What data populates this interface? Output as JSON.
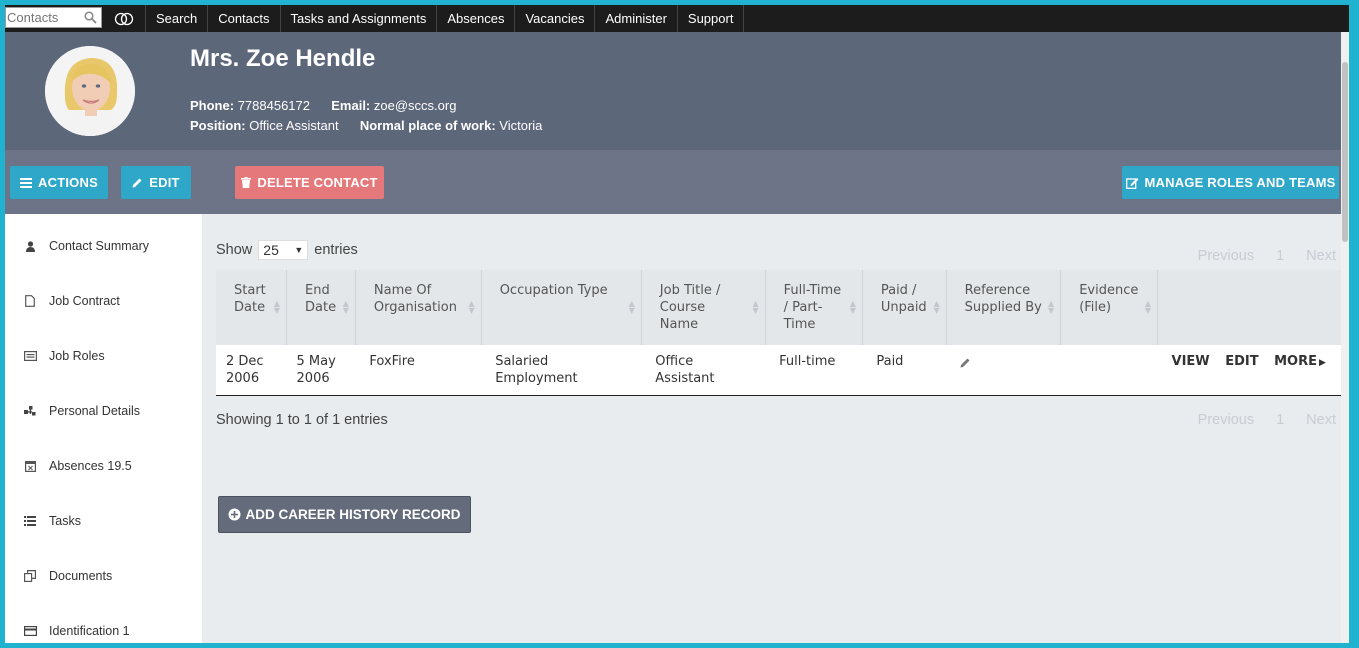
{
  "topnav": {
    "search_placeholder": "Contacts",
    "items": [
      "Search",
      "Contacts",
      "Tasks and Assignments",
      "Absences",
      "Vacancies",
      "Administer",
      "Support"
    ]
  },
  "profile": {
    "name": "Mrs. Zoe Hendle",
    "phone_label": "Phone:",
    "phone": "7788456172",
    "email_label": "Email:",
    "email": "zoe@sccs.org",
    "position_label": "Position:",
    "position": "Office Assistant",
    "workplace_label": "Normal place of work:",
    "workplace": "Victoria"
  },
  "actions": {
    "actions_label": "ACTIONS",
    "edit_label": "EDIT",
    "delete_label": "DELETE CONTACT",
    "manage_label": "MANAGE ROLES AND TEAMS"
  },
  "sidebar": {
    "items": [
      {
        "label": "Contact Summary",
        "icon": "person-icon"
      },
      {
        "label": "Job Contract",
        "icon": "document-icon"
      },
      {
        "label": "Job Roles",
        "icon": "id-card-icon"
      },
      {
        "label": "Personal Details",
        "icon": "hierarchy-icon"
      },
      {
        "label": "Absences 19.5",
        "icon": "calendar-icon"
      },
      {
        "label": "Tasks",
        "icon": "list-icon"
      },
      {
        "label": "Documents",
        "icon": "copy-icon"
      },
      {
        "label": "Identification 1",
        "icon": "credit-card-icon"
      }
    ]
  },
  "table": {
    "show_label": "Show",
    "page_size": "25",
    "entries_label": "entries",
    "pager": {
      "previous": "Previous",
      "page": "1",
      "next": "Next"
    },
    "headers": [
      "Start Date",
      "End Date",
      "Name Of Organisation",
      "Occupation Type",
      "Job Title / Course Name",
      "Full-Time / Part-Time",
      "Paid / Unpaid",
      "Reference Supplied By",
      "Evidence (File)"
    ],
    "rows": [
      {
        "start_date": "2 Dec 2006",
        "end_date": "5 May 2006",
        "organisation": "FoxFire",
        "occupation_type": "Salaried Employment",
        "job_title": "Office Assistant",
        "full_time": "Full-time",
        "paid": "Paid",
        "view": "VIEW",
        "edit": "EDIT",
        "more": "MORE"
      }
    ],
    "showing": "Showing 1 to 1 of 1 entries"
  },
  "add_button_label": "ADD CAREER HISTORY RECORD",
  "colors": {
    "accent": "#2ea7c9",
    "danger": "#e4787a",
    "header_bg": "#5d677a",
    "frame": "#1fb3d0"
  }
}
